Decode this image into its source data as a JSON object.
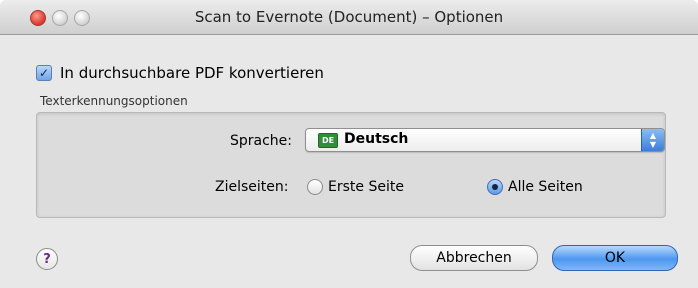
{
  "window": {
    "title": "Scan to Evernote (Document) – Optionen"
  },
  "options": {
    "convert_label": "In durchsuchbare PDF konvertieren",
    "convert_checked": true,
    "group_title": "Texterkennungsoptionen",
    "language_label": "Sprache:",
    "language_value": "Deutsch",
    "language_flag": "DE",
    "pages_label": "Zielseiten:",
    "pages_options": [
      "Erste Seite",
      "Alle Seiten"
    ],
    "pages_selected": "Alle Seiten"
  },
  "buttons": {
    "help": "?",
    "cancel": "Abbrechen",
    "ok": "OK"
  },
  "icons": {
    "close": "close-icon",
    "minimize": "minimize-icon",
    "zoom": "zoom-icon",
    "checkmark": "✓",
    "select_up": "▲",
    "select_down": "▼"
  }
}
